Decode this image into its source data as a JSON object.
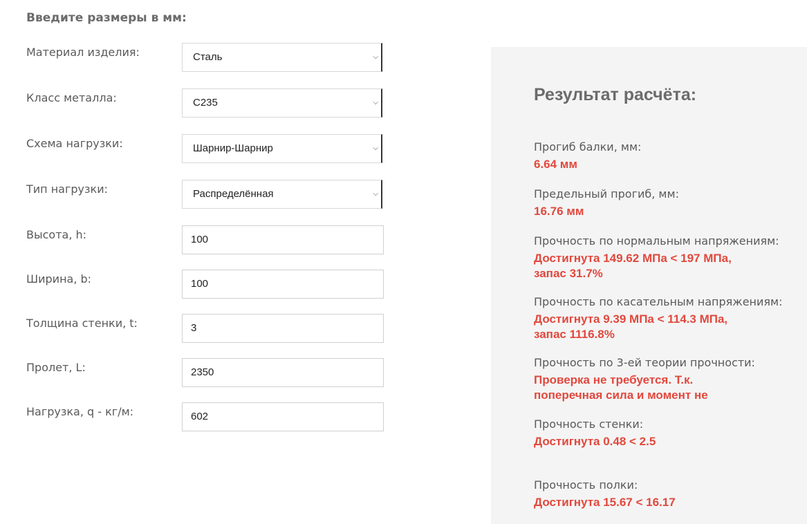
{
  "form": {
    "heading": "Введите размеры в мм:",
    "fields": [
      {
        "label": "Материал изделия:",
        "value": "Сталь",
        "type": "select"
      },
      {
        "label": "Класс металла:",
        "value": "С235",
        "type": "select"
      },
      {
        "label": "Схема нагрузки:",
        "value": "Шарнир-Шарнир",
        "type": "select"
      },
      {
        "label": "Тип нагрузки:",
        "value": "Распределённая",
        "type": "select"
      },
      {
        "label": "Высота, h:",
        "value": "100",
        "type": "input"
      },
      {
        "label": "Ширина, b:",
        "value": "100",
        "type": "input"
      },
      {
        "label": "Толщина стенки, t:",
        "value": "3",
        "type": "input"
      },
      {
        "label": "Пролет, L:",
        "value": "2350",
        "type": "input"
      },
      {
        "label": "Нагрузка, q - кг/м:",
        "value": "602",
        "type": "input"
      }
    ]
  },
  "results": {
    "title": "Результат расчёта:",
    "items": [
      {
        "label": "Прогиб балки, мм:",
        "value": "6.64 мм"
      },
      {
        "label": "Предельный прогиб, мм:",
        "value": "16.76 мм"
      },
      {
        "label": "Прочность по нормальным напряжениям:",
        "value": "Достигнута 149.62 МПа < 197 МПа, запас 31.7%"
      },
      {
        "label": "Прочность по касательным напряжениям:",
        "value": "Достигнута 9.39 МПа < 114.3 МПа, запас 1116.8%"
      },
      {
        "label": "Прочность по 3-ей теории прочности:",
        "value": "Проверка не требуется. Т.к. поперечная сила и момент не"
      },
      {
        "label": "Прочность стенки:",
        "value": "Достигнута 0.48 < 2.5"
      },
      {
        "label": "Прочность полки:",
        "value": "Достигнута 15.67 < 16.17"
      }
    ]
  },
  "icons": {
    "select_arrow": "chevron-down-icon"
  },
  "colors": {
    "result_value": "#e2483d",
    "panel_bg": "#f4f4f4"
  }
}
